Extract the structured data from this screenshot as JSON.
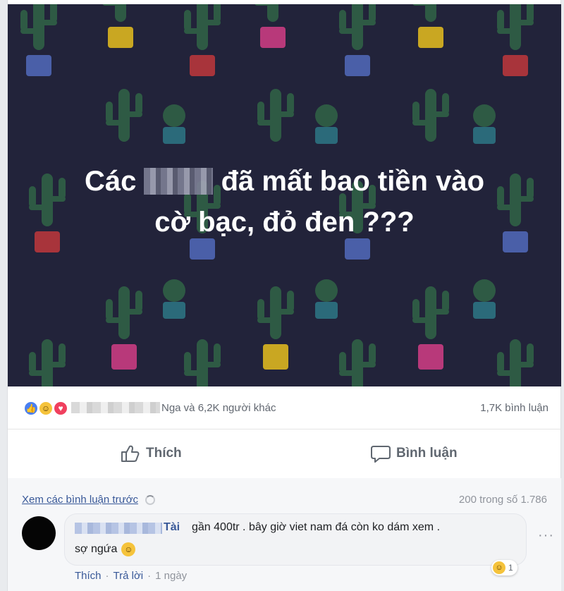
{
  "post": {
    "text_before_censor": "Các",
    "text_after_censor": "đã mất bao tiền vào",
    "text_line2": "cờ bạc, đỏ đen ???",
    "background_color": "#22233a"
  },
  "reactions": {
    "icons": [
      "like-icon",
      "haha-icon",
      "love-icon"
    ],
    "summary": "Nga và 6,2K người khác",
    "comment_count": "1,7K bình luận"
  },
  "actions": {
    "like_label": "Thích",
    "comment_label": "Bình luận"
  },
  "comments": {
    "view_previous": "Xem các bình luận trước",
    "count_of": "200 trong số 1.786",
    "items": [
      {
        "author": "Tài",
        "text": "gần 400tr . bây giờ viet nam đá còn ko dám xem .",
        "text_line2": "sợ ngứa",
        "like_label": "Thích",
        "reply_label": "Trả lời",
        "time": "1 ngày",
        "reaction_count": "1"
      }
    ]
  }
}
